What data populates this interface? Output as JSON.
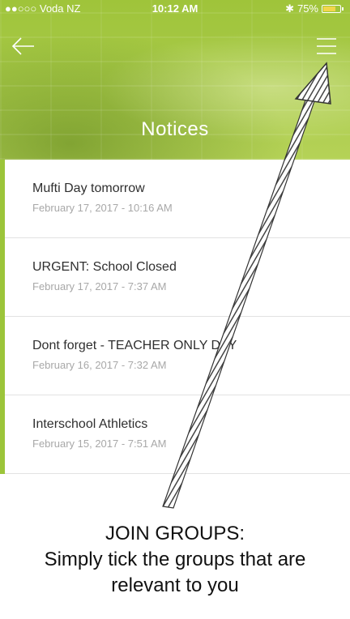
{
  "status_bar": {
    "carrier": "●●○○○ Voda NZ",
    "time": "10:12 AM",
    "battery": "75%",
    "battery_level": 0.75,
    "battery_color": "#f2d64b"
  },
  "header": {
    "title": "Notices",
    "back_icon": "arrow-left-icon",
    "menu_icon": "hamburger-menu-icon",
    "accent": "#9cc53a"
  },
  "notices": [
    {
      "title": "Mufti Day tomorrow",
      "date": "February 17, 2017 - 10:16 AM"
    },
    {
      "title": "URGENT: School Closed",
      "date": "February 17, 2017 - 7:37 AM"
    },
    {
      "title": "Dont forget - TEACHER ONLY DAY",
      "date": "February 16, 2017 - 7:32 AM"
    },
    {
      "title": "Interschool Athletics",
      "date": "February 15, 2017 - 7:51 AM"
    }
  ],
  "caption": {
    "line1": "JOIN GROUPS:",
    "line2": "Simply tick the groups that are",
    "line3": "relevant to you"
  }
}
